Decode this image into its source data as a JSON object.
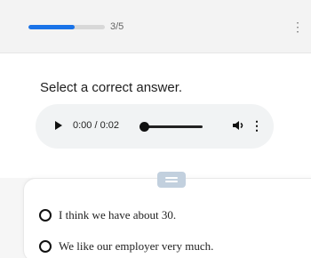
{
  "progress": {
    "label": "3/5",
    "current": 3,
    "total": 5,
    "fraction": 0.6,
    "color": "#1a73e8"
  },
  "header": {
    "menu_icon": "more-vertical-icon",
    "menu_glyph": "⋮"
  },
  "question": {
    "text": "Select a correct answer."
  },
  "audio": {
    "time": "0:00 / 0:02",
    "play_icon": "play-icon",
    "volume_icon": "volume-icon",
    "more_icon": "more-vertical-icon",
    "more_glyph": "⋮",
    "position_fraction": 0.0
  },
  "options": [
    {
      "text": "I think we have about 30."
    },
    {
      "text": "We like our employer very much."
    }
  ]
}
